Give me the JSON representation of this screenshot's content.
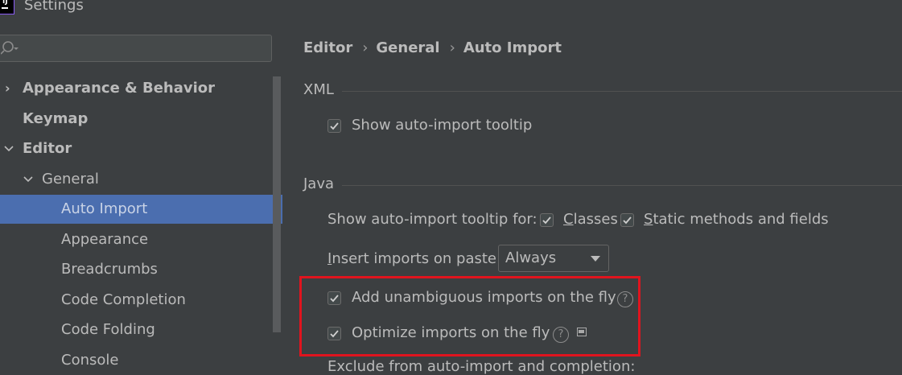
{
  "window": {
    "title": "Settings",
    "icon_text": "IJ"
  },
  "search": {
    "placeholder": "",
    "value": ""
  },
  "sidebar": {
    "items": [
      {
        "label": "Appearance & Behavior",
        "expanded": false
      },
      {
        "label": "Keymap"
      },
      {
        "label": "Editor",
        "expanded": true
      },
      {
        "label": "General",
        "expanded": true
      },
      {
        "label": "Auto Import",
        "selected": true
      },
      {
        "label": "Appearance"
      },
      {
        "label": "Breadcrumbs"
      },
      {
        "label": "Code Completion"
      },
      {
        "label": "Code Folding"
      },
      {
        "label": "Console"
      }
    ]
  },
  "breadcrumb": {
    "items": [
      "Editor",
      "General",
      "Auto Import"
    ],
    "separator": "›"
  },
  "xml": {
    "title": "XML",
    "show_tooltip": {
      "label": "Show auto-import tooltip",
      "checked": true
    }
  },
  "java": {
    "title": "Java",
    "tooltip_for_label": "Show auto-import tooltip for:",
    "classes": {
      "label_mnemonic": "C",
      "label_rest": "lasses",
      "checked": true
    },
    "static_methods": {
      "label_mnemonic": "S",
      "label_rest": "tatic methods and fields",
      "checked": true
    },
    "insert_on_paste": {
      "label_mnemonic": "I",
      "label_rest": "nsert imports on paste:",
      "value": "Always"
    },
    "add_unambiguous": {
      "label": "Add unambiguous imports on the fly",
      "checked": true
    },
    "optimize_imports": {
      "label": "Optimize imports on the fly",
      "checked": true
    },
    "exclude_label": "Exclude from auto-import and completion:"
  },
  "icons": {
    "help": "?",
    "search": "search-icon",
    "help_icon": "question-circle-icon",
    "doc_icon": "document-icon"
  },
  "colors": {
    "selection": "#4b6eaf",
    "highlight_border": "#e0141e",
    "background": "#3c3f41"
  }
}
